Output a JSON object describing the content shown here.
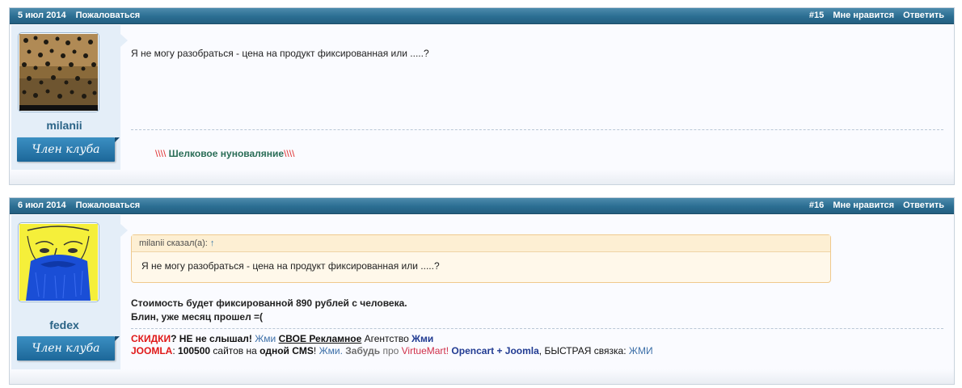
{
  "posts": [
    {
      "date": "5 июл 2014",
      "report": "Пожаловаться",
      "number": "#15",
      "like": "Мне нравится",
      "reply": "Ответить",
      "username": "milanii",
      "rank": "Член клуба",
      "message": "Я не могу разобраться - цена на продукт фиксированная или .....?",
      "signature": {
        "prefix": "\\\\\\\\",
        "text": " Шелковое нуноваляние",
        "suffix": "\\\\\\\\"
      }
    },
    {
      "date": "6 июл 2014",
      "report": "Пожаловаться",
      "number": "#16",
      "like": "Мне нравится",
      "reply": "Ответить",
      "username": "fedex",
      "rank": "Член клуба",
      "quote_author": "milanii сказал(а):",
      "quote_arrow": "↑",
      "quote_text": "Я не могу разобраться - цена на продукт фиксированная или .....?",
      "message_line1": "Стоимость будет фиксированной 890 рублей с человека.",
      "message_line2": "Блин, уже месяц прошел =(",
      "sig_line1": {
        "a": "СКИДКИ",
        "b": "? НЕ не слышал!",
        "c": " Жми",
        "d": "СВОЕ Рекламное",
        "e": " Агентство",
        "f": " Жми"
      },
      "sig_line2": {
        "a": "JOOMLA",
        "b": ": ",
        "c": "100500",
        "d": " сайтов на ",
        "e": "одной CMS",
        "f": "! ",
        "g": "Жми.",
        "h": " Забудь",
        "i": " про ",
        "j": "VirtueMart!",
        "k": " Opencart + Joomla",
        "l": ", БЫСТРАЯ связка: ",
        "m": "ЖМИ"
      }
    }
  ],
  "colors": {
    "header": "#2b6e92",
    "rank": "#1c6799",
    "username": "#2a6386",
    "quote_border": "#efc98d"
  }
}
